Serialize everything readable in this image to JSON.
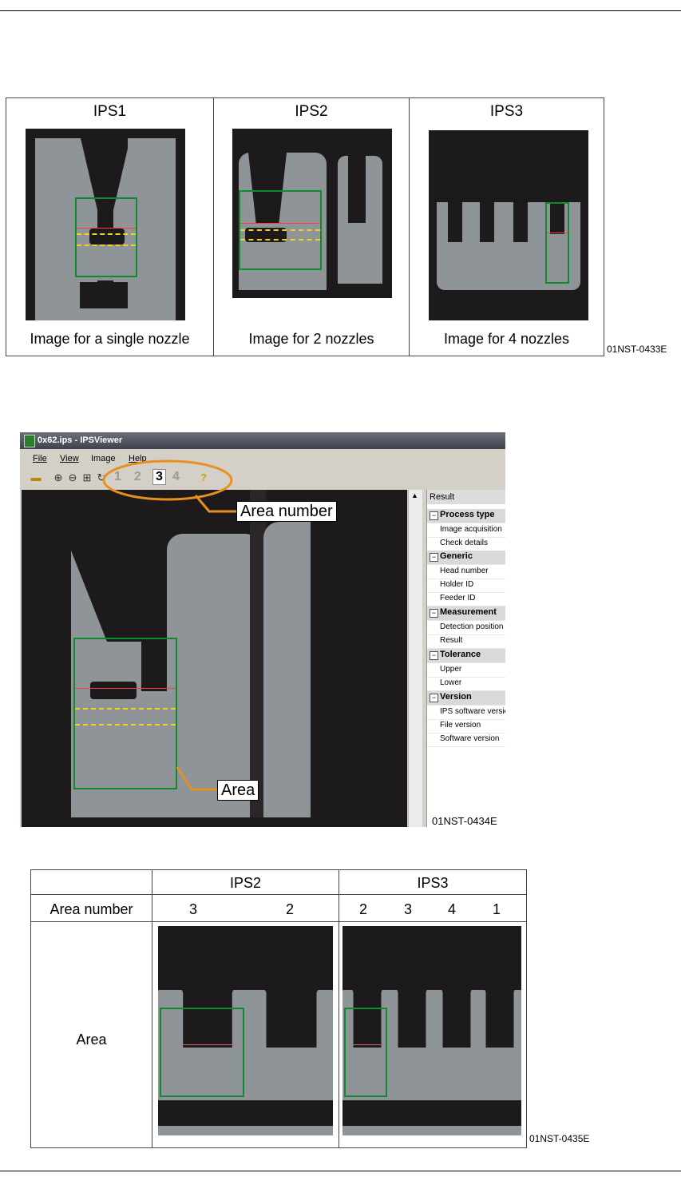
{
  "figure1": {
    "columns": [
      {
        "header": "IPS1",
        "caption": "Image for a single nozzle"
      },
      {
        "header": "IPS2",
        "caption": "Image for 2 nozzles"
      },
      {
        "header": "IPS3",
        "caption": "Image for 4 nozzles"
      }
    ],
    "figure_id": "01NST-0433E"
  },
  "viewer": {
    "title": "0x62.ips - IPSViewer",
    "menu": [
      "File",
      "View",
      "Image",
      "Help"
    ],
    "area_numbers": [
      "1",
      "2",
      "3",
      "4"
    ],
    "selected_area": "3",
    "panel_header": "Result",
    "property_groups": [
      {
        "name": "Process type",
        "items": [
          "Image acquisition",
          "Check details"
        ]
      },
      {
        "name": "Generic",
        "items": [
          "Head number",
          "Holder ID",
          "Feeder ID"
        ]
      },
      {
        "name": "Measurement",
        "items": [
          "Detection position",
          "Result"
        ]
      },
      {
        "name": "Tolerance",
        "items": [
          "Upper",
          "Lower"
        ]
      },
      {
        "name": "Version",
        "items": [
          "IPS software version",
          "File version",
          "Software version"
        ]
      }
    ],
    "callout_area_number": "Area number",
    "callout_area": "Area",
    "figure_id": "01NST-0434E",
    "icons": [
      "open-folder-icon",
      "zoom-in-icon",
      "zoom-out-icon",
      "fit-icon",
      "rotate-icon",
      "help-icon"
    ]
  },
  "figure3": {
    "header_ips2": "IPS2",
    "header_ips3": "IPS3",
    "row_area_number_label": "Area number",
    "ips2_numbers": [
      "3",
      "2"
    ],
    "ips3_numbers": [
      "2",
      "3",
      "4",
      "1"
    ],
    "row_area_label": "Area",
    "figure_id": "01NST-0435E"
  },
  "colors": {
    "area_box": "#0f8a2f",
    "red_line": "#ff3b3b",
    "yellow_line": "#f2d21b",
    "callout_line": "#e8901f",
    "nozzle_gray": "#8f9498",
    "background_dark": "#1d1a1b"
  }
}
